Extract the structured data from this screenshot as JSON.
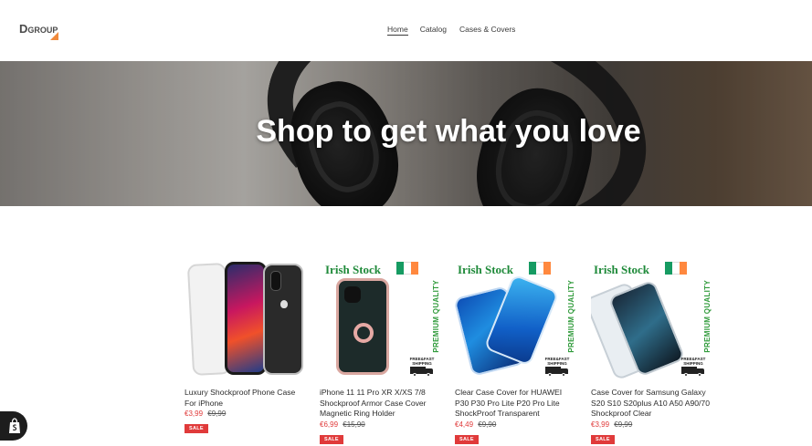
{
  "logo": {
    "text_big": "D",
    "text_small": "GROUP"
  },
  "nav": [
    {
      "label": "Home"
    },
    {
      "label": "Catalog"
    },
    {
      "label": "Cases & Covers"
    }
  ],
  "hero": {
    "title": "Shop to get what you love"
  },
  "products": [
    {
      "title": "Luxury Shockproof Phone Case For iPhone",
      "sale_price": "€3,99",
      "regular_price": "€9,99",
      "badge": "SALE"
    },
    {
      "title": "iPhone 11 11 Pro XR X/XS 7/8 Shockproof Armor Case Cover Magnetic Ring Holder",
      "sale_price": "€6,99",
      "regular_price": "€15,90",
      "badge": "SALE",
      "banner": "Irish Stock",
      "side_text": "PREMIUM QUALITY",
      "ship_text": "FREE&FAST SHIPPING"
    },
    {
      "title": "Clear Case Cover for HUAWEI P30 P30 Pro Lite P20 Pro Lite ShockProof Transparent",
      "sale_price": "€4,49",
      "regular_price": "€9,90",
      "badge": "SALE",
      "banner": "Irish Stock",
      "side_text": "PREMIUM QUALITY",
      "ship_text": "FREE&FAST SHIPPING"
    },
    {
      "title": "Case Cover for Samsung Galaxy S20 S10 S20plus A10 A50 A90/70 Shockproof Clear",
      "sale_price": "€3,99",
      "regular_price": "€9,99",
      "badge": "SALE",
      "banner": "Irish Stock",
      "side_text": "PREMIUM QUALITY",
      "ship_text": "FREE&FAST SHIPPING"
    }
  ],
  "colors": {
    "sale": "#e03a3a",
    "irish_green": "#1f8a3a",
    "flag": [
      "#169b62",
      "#ffffff",
      "#ff883e"
    ],
    "logo_accent": "#f08a3c"
  },
  "icons": {
    "floating": "shopify-bag-icon"
  }
}
